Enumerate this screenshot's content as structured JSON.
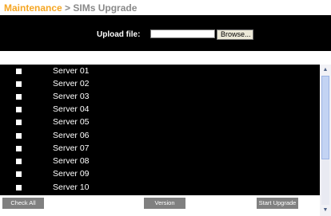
{
  "breadcrumb": {
    "root": "Maintenance",
    "separator": ">",
    "current": "SIMs Upgrade"
  },
  "upload": {
    "label": "Upload file:",
    "file_value": "",
    "browse_label": "Browse..."
  },
  "servers": [
    {
      "label": "Server 01",
      "checked": false
    },
    {
      "label": "Server 02",
      "checked": false
    },
    {
      "label": "Server 03",
      "checked": false
    },
    {
      "label": "Server 04",
      "checked": false
    },
    {
      "label": "Server 05",
      "checked": false
    },
    {
      "label": "Server 06",
      "checked": false
    },
    {
      "label": "Server 07",
      "checked": false
    },
    {
      "label": "Server 08",
      "checked": false
    },
    {
      "label": "Server 09",
      "checked": false
    },
    {
      "label": "Server 10",
      "checked": false
    }
  ],
  "scrollbar": {
    "up_icon": "triangle-up",
    "down_icon": "triangle-down"
  },
  "footer": {
    "check_all_label": "Check All",
    "version_label": "Version",
    "start_upgrade_label": "Start Upgrade"
  },
  "colors": {
    "accent": "#f5a623",
    "panel_background": "#000000",
    "button_gray": "#808080"
  }
}
